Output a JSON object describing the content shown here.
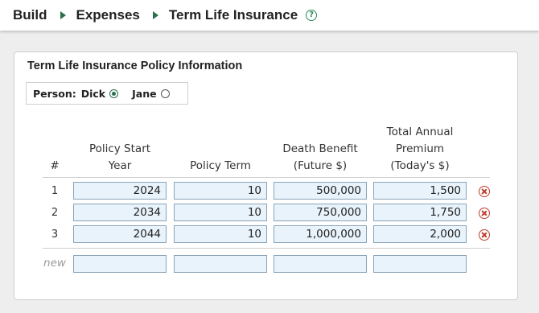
{
  "breadcrumb": {
    "items": [
      "Build",
      "Expenses",
      "Term Life Insurance"
    ],
    "help_icon": "question-circle-icon"
  },
  "card": {
    "title": "Term Life Insurance Policy Information",
    "person": {
      "label": "Person:",
      "options": [
        {
          "name": "Dick",
          "selected": true
        },
        {
          "name": "Jane",
          "selected": false
        }
      ]
    },
    "table": {
      "headers": {
        "num": "#",
        "start_year": [
          "Policy Start",
          "Year"
        ],
        "term": "Policy Term",
        "benefit": [
          "Death Benefit",
          "(Future $)"
        ],
        "premium": [
          "Total Annual",
          "Premium",
          "(Today's $)"
        ]
      },
      "rows": [
        {
          "num": "1",
          "start_year": "2024",
          "term": "10",
          "benefit": "500,000",
          "premium": "1,500"
        },
        {
          "num": "2",
          "start_year": "2034",
          "term": "10",
          "benefit": "750,000",
          "premium": "1,750"
        },
        {
          "num": "3",
          "start_year": "2044",
          "term": "10",
          "benefit": "1,000,000",
          "premium": "2,000"
        }
      ],
      "new_row_label": "new",
      "delete_icon": "close-circle-icon"
    }
  },
  "colors": {
    "accent_green": "#2b6f4b",
    "delete_red": "#c0392b",
    "input_bg": "#e8f3fb"
  }
}
